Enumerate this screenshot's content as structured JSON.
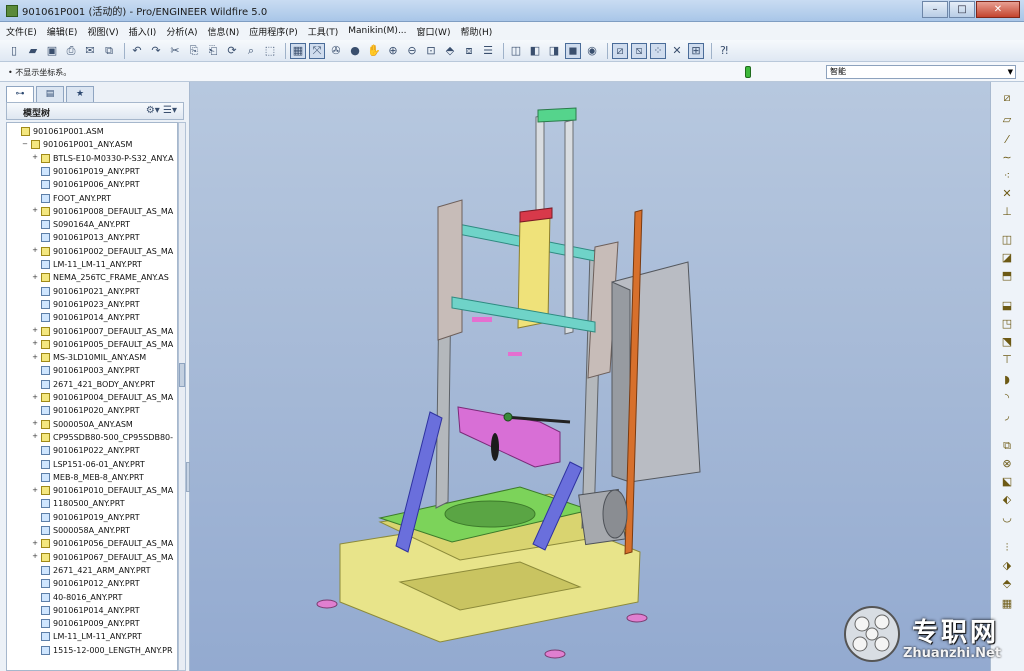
{
  "window": {
    "title": "901061P001 (活动的) - Pro/ENGINEER Wildfire 5.0",
    "minimize": "–",
    "maximize": "□",
    "close": "✕"
  },
  "menu": [
    "文件(E)",
    "编辑(E)",
    "视图(V)",
    "插入(I)",
    "分析(A)",
    "信息(N)",
    "应用程序(P)",
    "工具(T)",
    "Manikin(M)...",
    "窗口(W)",
    "帮助(H)"
  ],
  "toolbar_icons": [
    "new-file",
    "open-folder",
    "save",
    "print",
    "undo",
    "redo",
    "cut",
    "copy",
    "paste",
    "regenerate",
    "sketch",
    "zoom-in",
    "zoom-out",
    "refit",
    "spin",
    "shading",
    "datum-planes",
    "datum-axes",
    "datum-points",
    "csys",
    "help"
  ],
  "message": "• 不显示坐标系。",
  "filter": {
    "value": "智能"
  },
  "model_tree": {
    "title": "模型树",
    "tabs": [
      "model-tree-tab",
      "layers-tab",
      "folder-tab"
    ],
    "items": [
      {
        "label": "901061P001.ASM",
        "level": 0,
        "type": "asm",
        "expand": ""
      },
      {
        "label": "901061P001_ANY.ASM",
        "level": 1,
        "type": "asm",
        "expand": "−"
      },
      {
        "label": "BTLS-E10-M0330-P-S32_ANY.A",
        "level": 2,
        "type": "asm",
        "expand": "+"
      },
      {
        "label": "901061P019_ANY.PRT",
        "level": 2,
        "type": "prt",
        "expand": ""
      },
      {
        "label": "901061P006_ANY.PRT",
        "level": 2,
        "type": "prt",
        "expand": ""
      },
      {
        "label": "FOOT_ANY.PRT",
        "level": 2,
        "type": "prt",
        "expand": ""
      },
      {
        "label": "901061P008_DEFAULT_AS_MA",
        "level": 2,
        "type": "asm",
        "expand": "+"
      },
      {
        "label": "S090164A_ANY.PRT",
        "level": 2,
        "type": "prt",
        "expand": ""
      },
      {
        "label": "901061P013_ANY.PRT",
        "level": 2,
        "type": "prt",
        "expand": ""
      },
      {
        "label": "901061P002_DEFAULT_AS_MA",
        "level": 2,
        "type": "asm",
        "expand": "+"
      },
      {
        "label": "LM-11_LM-11_ANY.PRT",
        "level": 2,
        "type": "prt",
        "expand": ""
      },
      {
        "label": "NEMA_256TC_FRAME_ANY.AS",
        "level": 2,
        "type": "asm",
        "expand": "+"
      },
      {
        "label": "901061P021_ANY.PRT",
        "level": 2,
        "type": "prt",
        "expand": ""
      },
      {
        "label": "901061P023_ANY.PRT",
        "level": 2,
        "type": "prt",
        "expand": ""
      },
      {
        "label": "901061P014_ANY.PRT",
        "level": 2,
        "type": "prt",
        "expand": ""
      },
      {
        "label": "901061P007_DEFAULT_AS_MA",
        "level": 2,
        "type": "asm",
        "expand": "+"
      },
      {
        "label": "901061P005_DEFAULT_AS_MA",
        "level": 2,
        "type": "asm",
        "expand": "+"
      },
      {
        "label": "MS-3LD10MIL_ANY.ASM",
        "level": 2,
        "type": "asm",
        "expand": "+"
      },
      {
        "label": "901061P003_ANY.PRT",
        "level": 2,
        "type": "prt",
        "expand": ""
      },
      {
        "label": "2671_421_BODY_ANY.PRT",
        "level": 2,
        "type": "prt",
        "expand": ""
      },
      {
        "label": "901061P004_DEFAULT_AS_MA",
        "level": 2,
        "type": "asm",
        "expand": "+"
      },
      {
        "label": "901061P020_ANY.PRT",
        "level": 2,
        "type": "prt",
        "expand": ""
      },
      {
        "label": "S000050A_ANY.ASM",
        "level": 2,
        "type": "asm",
        "expand": "+"
      },
      {
        "label": "CP95SDB80-500_CP95SDB80-",
        "level": 2,
        "type": "asm",
        "expand": "+"
      },
      {
        "label": "901061P022_ANY.PRT",
        "level": 2,
        "type": "prt",
        "expand": ""
      },
      {
        "label": "LSP151-06-01_ANY.PRT",
        "level": 2,
        "type": "prt",
        "expand": ""
      },
      {
        "label": "MEB-8_MEB-8_ANY.PRT",
        "level": 2,
        "type": "prt",
        "expand": ""
      },
      {
        "label": "901061P010_DEFAULT_AS_MA",
        "level": 2,
        "type": "asm",
        "expand": "+"
      },
      {
        "label": "1180500_ANY.PRT",
        "level": 2,
        "type": "prt",
        "expand": ""
      },
      {
        "label": "901061P019_ANY.PRT",
        "level": 2,
        "type": "prt",
        "expand": ""
      },
      {
        "label": "S000058A_ANY.PRT",
        "level": 2,
        "type": "prt",
        "expand": ""
      },
      {
        "label": "901061P056_DEFAULT_AS_MA",
        "level": 2,
        "type": "asm",
        "expand": "+"
      },
      {
        "label": "901061P067_DEFAULT_AS_MA",
        "level": 2,
        "type": "asm",
        "expand": "+"
      },
      {
        "label": "2671_421_ARM_ANY.PRT",
        "level": 2,
        "type": "prt",
        "expand": ""
      },
      {
        "label": "901061P012_ANY.PRT",
        "level": 2,
        "type": "prt",
        "expand": ""
      },
      {
        "label": "40-8016_ANY.PRT",
        "level": 2,
        "type": "prt",
        "expand": ""
      },
      {
        "label": "901061P014_ANY.PRT",
        "level": 2,
        "type": "prt",
        "expand": ""
      },
      {
        "label": "901061P009_ANY.PRT",
        "level": 2,
        "type": "prt",
        "expand": ""
      },
      {
        "label": "LM-11_LM-11_ANY.PRT",
        "level": 2,
        "type": "prt",
        "expand": ""
      },
      {
        "label": "1515-12-000_LENGTH_ANY.PR",
        "level": 2,
        "type": "prt",
        "expand": ""
      }
    ]
  },
  "right_toolbar_icons": [
    "datum-plane",
    "sketch-plane",
    "datum-axis",
    "datum-curve",
    "datum-point",
    "coordinate-system",
    "analysis",
    "hole",
    "shell",
    "rib",
    "draft",
    "round",
    "chamfer",
    "pattern",
    "mirror",
    "merge",
    "trim",
    "extend",
    "offset",
    "thicken",
    "solidify"
  ],
  "colors": {
    "viewport_top": "#b7c8df",
    "viewport_bottom": "#93aad0",
    "base_yellow": "#e8e48a",
    "frame_gray": "#b4b8bc",
    "cyan_bar": "#6fd3c8",
    "green_plate": "#7cd35a",
    "magenta_part": "#d86fd6",
    "blue_legs": "#6a6fdc",
    "cabinet": "#b9bcc3",
    "orange_rod": "#d7702c"
  },
  "watermark": {
    "cn": "专职网",
    "en": "Zhuanzhi.Net"
  }
}
